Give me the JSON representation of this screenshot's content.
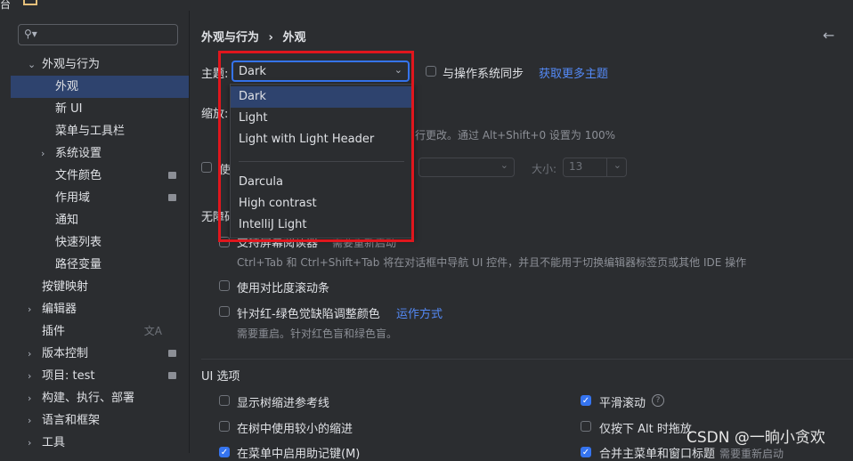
{
  "window": {
    "title_fragment": "台"
  },
  "search": {
    "placeholder": ""
  },
  "sidebar": {
    "items": [
      {
        "label": "外观与行为",
        "expanded": true
      },
      {
        "label": "外观",
        "selected": true
      },
      {
        "label": "新 UI"
      },
      {
        "label": "菜单与工具栏"
      },
      {
        "label": "系统设置",
        "collapsed": true
      },
      {
        "label": "文件颜色"
      },
      {
        "label": "作用域"
      },
      {
        "label": "通知"
      },
      {
        "label": "快速列表"
      },
      {
        "label": "路径变量"
      },
      {
        "label": "按键映射"
      },
      {
        "label": "编辑器",
        "collapsed": true
      },
      {
        "label": "插件"
      },
      {
        "label": "版本控制",
        "collapsed": true
      },
      {
        "label": "项目: test",
        "collapsed": true
      },
      {
        "label": "构建、执行、部署",
        "collapsed": true
      },
      {
        "label": "语言和框架",
        "collapsed": true
      },
      {
        "label": "工具",
        "collapsed": true
      }
    ]
  },
  "breadcrumb": {
    "parent": "外观与行为",
    "sep": "›",
    "current": "外观"
  },
  "theme": {
    "label": "主题:",
    "value": "Dark",
    "sync_label": "与操作系统同步",
    "more_link": "获取更多主题",
    "options": [
      "Dark",
      "Light",
      "Light with Light Header",
      "Darcula",
      "High contrast",
      "IntelliJ Light"
    ],
    "selected": "Dark"
  },
  "zoom": {
    "label": "缩放:",
    "hint": "行更改。通过 Alt+Shift+0 设置为 100%"
  },
  "font": {
    "use_label": "使",
    "size_label": "大小:",
    "size_value": "13"
  },
  "accessibility": {
    "section_label": "无障碍",
    "screen_reader_label": "支持屏幕阅读器",
    "screen_reader_hint": "需要重新启动",
    "screen_reader_desc": "Ctrl+Tab 和 Ctrl+Shift+Tab 将在对话框中导航 UI 控件，并且不能用于切换编辑器标签页或其他 IDE 操作",
    "contrast_scrollbars": "使用对比度滚动条",
    "color_deficiency": "针对红-绿色觉缺陷调整颜色",
    "how_it_works": "运作方式",
    "restart_hint": "需要重启。针对红色盲和绿色盲。"
  },
  "ui_options": {
    "title": "UI 选项",
    "tree_guides": "显示树缩进参考线",
    "smooth_scroll": "平滑滚动",
    "smaller_indent": "在树中使用较小的缩进",
    "alt_only": "仅按下 Alt 时拖放",
    "mnemonics_menu": "在菜单中启用助记键(M)",
    "merge_menu": "合并主菜单和窗口标题",
    "merge_hint": "需要重新启动"
  },
  "watermark": "CSDN @一晌小贪欢",
  "colors": {
    "accent": "#3574f0",
    "selection": "#2e436e",
    "highlight_box": "#e0161d",
    "link": "#548af7"
  }
}
